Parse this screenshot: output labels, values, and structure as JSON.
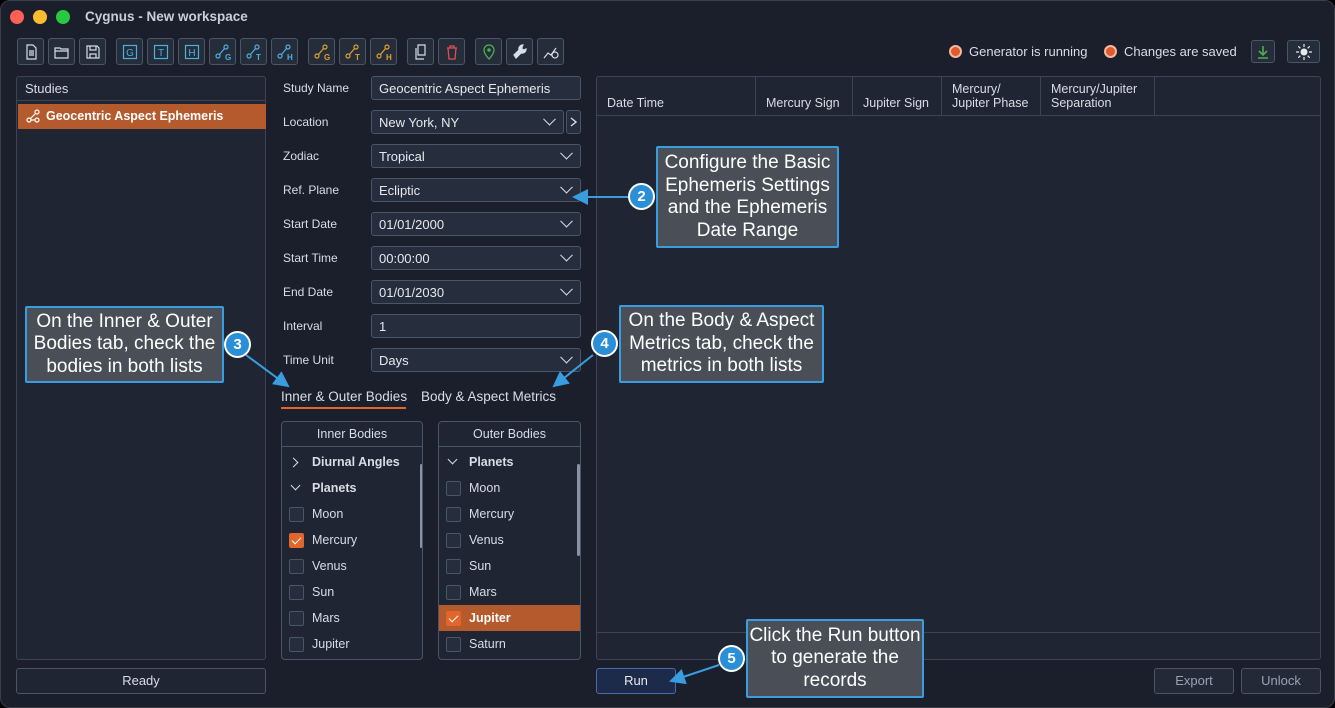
{
  "window": {
    "title": "Cygnus - New workspace"
  },
  "toolbar": {
    "buttons": [
      {
        "icon": "new-file-icon"
      },
      {
        "icon": "open-folder-icon"
      },
      {
        "icon": "save-icon"
      },
      {
        "icon": "g-box-icon",
        "letter": "G"
      },
      {
        "icon": "t-box-icon",
        "letter": "T"
      },
      {
        "icon": "h-box-icon",
        "letter": "H"
      },
      {
        "icon": "chart-g-icon"
      },
      {
        "icon": "chart-t-icon"
      },
      {
        "icon": "chart-h-icon"
      },
      {
        "icon": "orange-chart-g-icon"
      },
      {
        "icon": "orange-chart-t-icon"
      },
      {
        "icon": "orange-chart-h-icon"
      },
      {
        "icon": "copy-icon"
      },
      {
        "icon": "trash-icon"
      },
      {
        "icon": "location-pin-icon"
      },
      {
        "icon": "wrench-icon"
      },
      {
        "icon": "settings-chart-icon"
      }
    ],
    "status_generator": "Generator is running",
    "status_changes": "Changes are saved",
    "download_icon": "download-icon",
    "theme_icon": "sun-icon"
  },
  "studies": {
    "header": "Studies",
    "items": [
      {
        "label": "Geocentric Aspect Ephemeris",
        "icon": "aspect-icon"
      }
    ],
    "status": "Ready"
  },
  "form": {
    "study_name_label": "Study Name",
    "study_name": "Geocentric Aspect Ephemeris",
    "location_label": "Location",
    "location": "New York, NY",
    "zodiac_label": "Zodiac",
    "zodiac": "Tropical",
    "ref_plane_label": "Ref. Plane",
    "ref_plane": "Ecliptic",
    "start_date_label": "Start Date",
    "start_date": "01/01/2000",
    "start_time_label": "Start Time",
    "start_time": "00:00:00",
    "end_date_label": "End Date",
    "end_date": "01/01/2030",
    "interval_label": "Interval",
    "interval": "1",
    "time_unit_label": "Time Unit",
    "time_unit": "Days"
  },
  "tabs": [
    {
      "label": "Inner & Outer Bodies",
      "active": true
    },
    {
      "label": "Body & Aspect Metrics",
      "active": false
    }
  ],
  "inner_bodies": {
    "header": "Inner Bodies",
    "rows": [
      {
        "label": "Diurnal Angles",
        "group": true,
        "expanded": false
      },
      {
        "label": "Planets",
        "group": true,
        "expanded": true
      },
      {
        "label": "Moon",
        "checked": false
      },
      {
        "label": "Mercury",
        "checked": true
      },
      {
        "label": "Venus",
        "checked": false
      },
      {
        "label": "Sun",
        "checked": false
      },
      {
        "label": "Mars",
        "checked": false
      },
      {
        "label": "Jupiter",
        "checked": false
      }
    ]
  },
  "outer_bodies": {
    "header": "Outer Bodies",
    "rows": [
      {
        "label": "Planets",
        "group": true,
        "expanded": true
      },
      {
        "label": "Moon",
        "checked": false
      },
      {
        "label": "Mercury",
        "checked": false
      },
      {
        "label": "Venus",
        "checked": false
      },
      {
        "label": "Sun",
        "checked": false
      },
      {
        "label": "Mars",
        "checked": false
      },
      {
        "label": "Jupiter",
        "checked": true,
        "selected": true
      },
      {
        "label": "Saturn",
        "checked": false
      }
    ]
  },
  "results": {
    "columns": [
      {
        "line1": "",
        "line2": "Date Time"
      },
      {
        "line1": "",
        "line2": "Mercury Sign"
      },
      {
        "line1": "",
        "line2": "Jupiter Sign"
      },
      {
        "line1": "Mercury/",
        "line2": "Jupiter Phase"
      },
      {
        "line1": "Mercury/Jupiter",
        "line2": "Separation"
      }
    ]
  },
  "actions": {
    "run": "Run",
    "export": "Export",
    "unlock": "Unlock"
  },
  "callouts": {
    "c2_num": "2",
    "c2_text": "Configure the Basic Ephemeris Settings and the Ephemeris Date Range",
    "c3_num": "3",
    "c3_text": "On the Inner & Outer Bodies tab, check the bodies in both lists",
    "c4_num": "4",
    "c4_text": "On the Body & Aspect Metrics tab, check the metrics in both lists",
    "c5_num": "5",
    "c5_text": "Click the Run button to generate the records"
  },
  "colors": {
    "accent": "#e0662b",
    "callout_border": "#3a9de0",
    "background": "#1a1f2b"
  }
}
